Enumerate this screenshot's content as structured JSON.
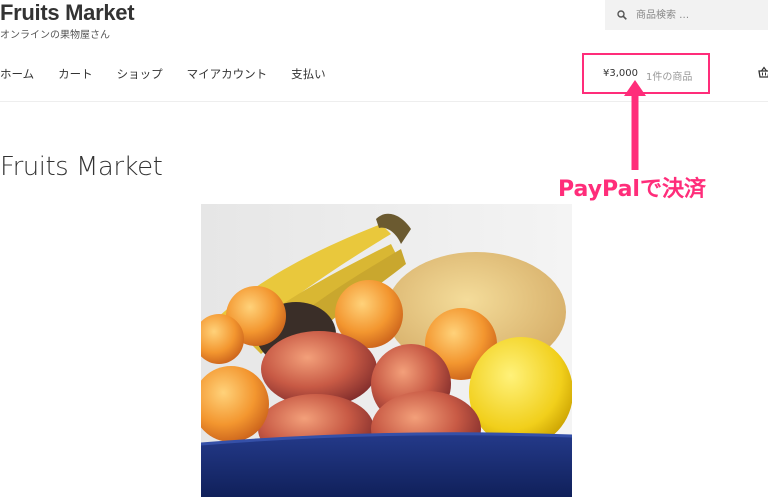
{
  "site": {
    "title": "Fruits Market",
    "tagline": "オンラインの果物屋さん"
  },
  "search": {
    "placeholder": "商品検索 …",
    "icon": "search-icon"
  },
  "nav": {
    "items": [
      "ホーム",
      "カート",
      "ショップ",
      "マイアカウント",
      "支払い"
    ]
  },
  "cart": {
    "amount": "¥3,000",
    "count_label": "1件の商品",
    "icon": "basket-icon"
  },
  "annotation": {
    "text": "PayPalで決済",
    "color": "#ff2d7a"
  },
  "page": {
    "title": "Fruits Market"
  },
  "hero_image": {
    "subject": "bowl-of-fruit"
  },
  "colors": {
    "accent": "#ff2d7a",
    "search_bg": "#f2f2f2",
    "text": "#333333"
  }
}
